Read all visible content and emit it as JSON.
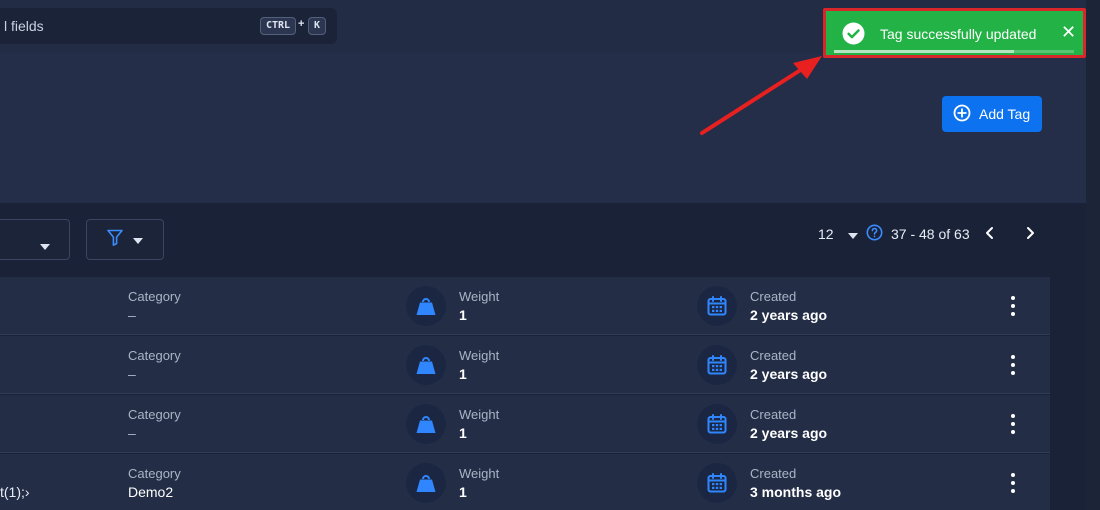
{
  "search": {
    "text": "l fields",
    "shortcut_ctrl": "CTRL",
    "shortcut_plus": "+",
    "shortcut_key": "K"
  },
  "header": {
    "add_tag_label": "Add Tag"
  },
  "pagination": {
    "per_page": "12",
    "range": "37 - 48 of 63"
  },
  "toast": {
    "message": "Tag successfully updated",
    "close_glyph": "✕",
    "progress": 0.75,
    "color": "#22b245",
    "highlight_color": "#d8262b"
  },
  "table": {
    "rows": [
      {
        "name": "",
        "category_label": "Category",
        "category": "–",
        "weight_label": "Weight",
        "weight": "1",
        "created_label": "Created",
        "created": "2 years ago"
      },
      {
        "name": "",
        "category_label": "Category",
        "category": "–",
        "weight_label": "Weight",
        "weight": "1",
        "created_label": "Created",
        "created": "2 years ago"
      },
      {
        "name": "",
        "category_label": "Category",
        "category": "–",
        "weight_label": "Weight",
        "weight": "1",
        "created_label": "Created",
        "created": "2 years ago"
      },
      {
        "name": "t(1);›",
        "category_label": "Category",
        "category": "Demo2",
        "weight_label": "Weight",
        "weight": "1",
        "created_label": "Created",
        "created": "3 months ago"
      }
    ]
  },
  "icons": {
    "weight": "weight-icon",
    "created": "calendar-icon",
    "filter": "filter-icon",
    "help": "help-icon",
    "more": "more-vertical-icon"
  },
  "colors": {
    "accent": "#0d72f0",
    "background": "#1a2238"
  }
}
